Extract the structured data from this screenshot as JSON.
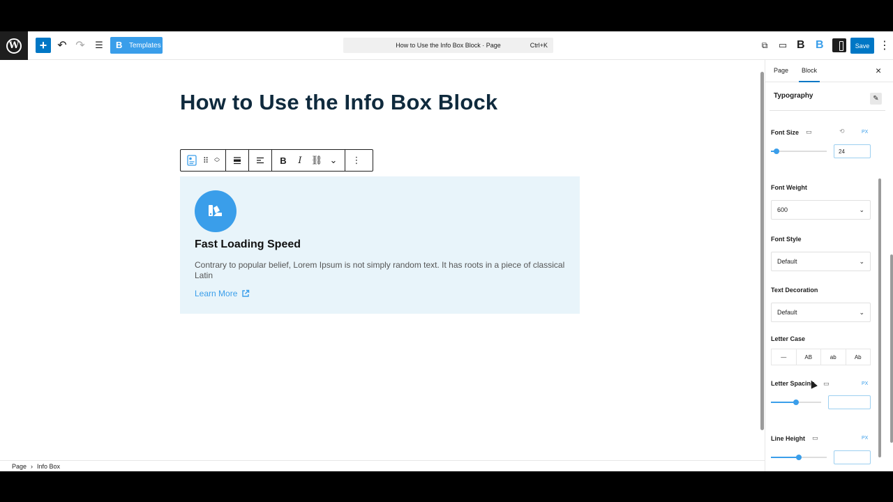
{
  "toolbar": {
    "templates_label": "Templates",
    "command_title": "How to Use the Info Box Block · Page",
    "command_shortcut": "Ctrl+K",
    "save_label": "Save",
    "add_icon": "+",
    "undo_icon": "↶",
    "redo_icon": "↷",
    "list_icon": "☰",
    "view_icon": "⧉",
    "preview_icon": "▭",
    "brand_letter": "B",
    "more_icon": "⋮"
  },
  "post": {
    "title": "How to Use the Info Box Block"
  },
  "block_toolbar": {
    "bold": "B",
    "italic": "I",
    "link": "⛓",
    "more": "⌄",
    "options": "⋮"
  },
  "info_box": {
    "title": "Fast Loading Speed",
    "text": "Contrary to popular belief, Lorem Ipsum is not simply random text. It has roots in a piece of classical Latin",
    "link_label": "Learn More"
  },
  "breadcrumb": {
    "items": [
      "Page",
      "Info Box"
    ],
    "separator": "›"
  },
  "sidebar": {
    "tabs": [
      "Page",
      "Block"
    ],
    "active_tab": "Block",
    "close_icon": "×",
    "section": "Typography",
    "font_size": {
      "label": "Font Size",
      "unit": "PX",
      "value": "24",
      "level": 0.1
    },
    "font_weight": {
      "label": "Font Weight",
      "value": "600"
    },
    "font_style": {
      "label": "Font Style",
      "value": "Default"
    },
    "text_decoration": {
      "label": "Text Decoration",
      "value": "Default"
    },
    "letter_case": {
      "label": "Letter Case",
      "options": [
        "—",
        "AB",
        "ab",
        "Ab"
      ]
    },
    "letter_spacing": {
      "label": "Letter Spacing",
      "unit": "PX",
      "value": "",
      "level": 0.5
    },
    "line_height": {
      "label": "Line Height",
      "unit": "PX",
      "value": "",
      "level": 0.5
    }
  },
  "colors": {
    "accent": "#0077c5",
    "brand": "#3a9eea",
    "info_box_bg": "#e8f4fa",
    "title": "#0f2a3d"
  }
}
